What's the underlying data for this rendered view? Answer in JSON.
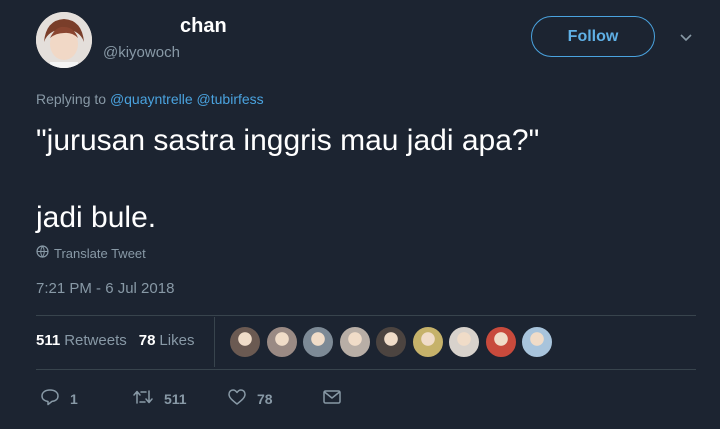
{
  "user": {
    "name": "chan",
    "handle": "@kiyowoch"
  },
  "follow_label": "Follow",
  "reply": {
    "prefix": "Replying to",
    "mentions": [
      "@quayntrelle",
      "@tubirfess"
    ]
  },
  "tweet": {
    "line1": "\"jurusan sastra inggris mau jadi apa?\"",
    "line2": "jadi bule."
  },
  "translate_label": "Translate Tweet",
  "timestamp": "7:21 PM - 6 Jul 2018",
  "stats": {
    "retweets_count": "511",
    "retweets_label": "Retweets",
    "likes_count": "78",
    "likes_label": "Likes"
  },
  "liker_colors": [
    "#6b5a52",
    "#9a8a84",
    "#7d8a96",
    "#b8aea6",
    "#4c4440",
    "#c6b26a",
    "#d8d2cc",
    "#c84a3c",
    "#a8c4dc"
  ],
  "actions": {
    "reply_count": "1",
    "retweet_count": "511",
    "like_count": "78"
  },
  "colors": {
    "background": "#1c2431",
    "accent": "#4aa3df",
    "muted": "#8899a6"
  }
}
